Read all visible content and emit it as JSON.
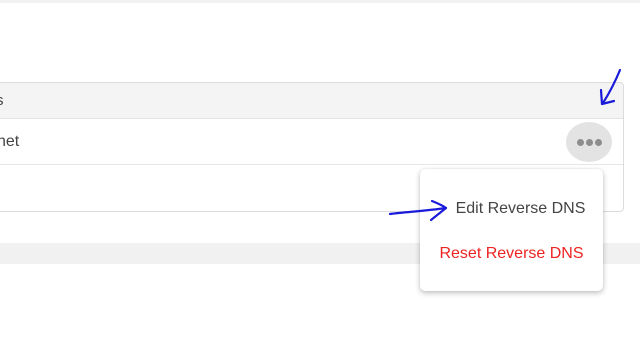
{
  "table": {
    "header_label": "s",
    "rows": [
      {
        "label": "net"
      }
    ]
  },
  "more_button": {
    "icon": "more-horizontal-icon"
  },
  "menu": {
    "items": [
      {
        "label": "Edit Reverse DNS",
        "color": "#444444"
      },
      {
        "label": "Reset Reverse DNS",
        "color": "#ee2222"
      }
    ]
  },
  "annotations": {
    "color": "#1a1adb"
  }
}
